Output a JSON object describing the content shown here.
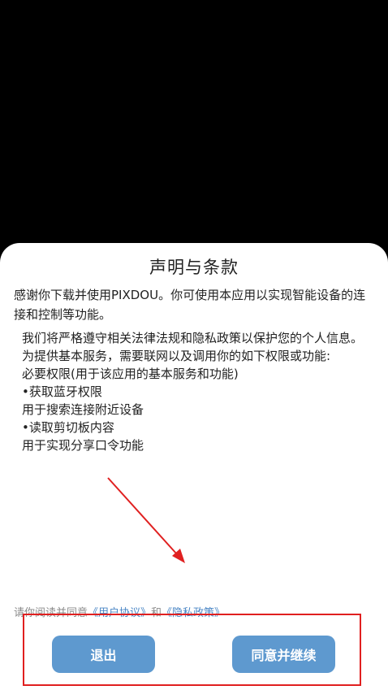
{
  "dialog": {
    "title": "声明与条款",
    "intro": "感谢你下载并使用PIXDOU。你可使用本应用以实现智能设备的连接和控制等功能。",
    "permissions": [
      "我们将严格遵守相关法律法规和隐私政策以保护您的个人信息。",
      "为提供基本服务，需要联网以及调用你的如下权限或功能:",
      "必要权限(用于该应用的基本服务和功能)",
      "•获取蓝牙权限",
      "用于搜索连接附近设备",
      "•读取剪切板内容",
      "用于实现分享口令功能"
    ],
    "agreement": {
      "prefix": "请你阅读并同意",
      "user_agreement": "《用户协议》",
      "conjunction": "和",
      "privacy_policy": "《隐私政策》"
    },
    "buttons": {
      "exit": "退出",
      "agree": "同意并继续"
    }
  },
  "colors": {
    "button": "#5e99cf",
    "link": "#4a86c5",
    "annotation": "#e02020"
  }
}
